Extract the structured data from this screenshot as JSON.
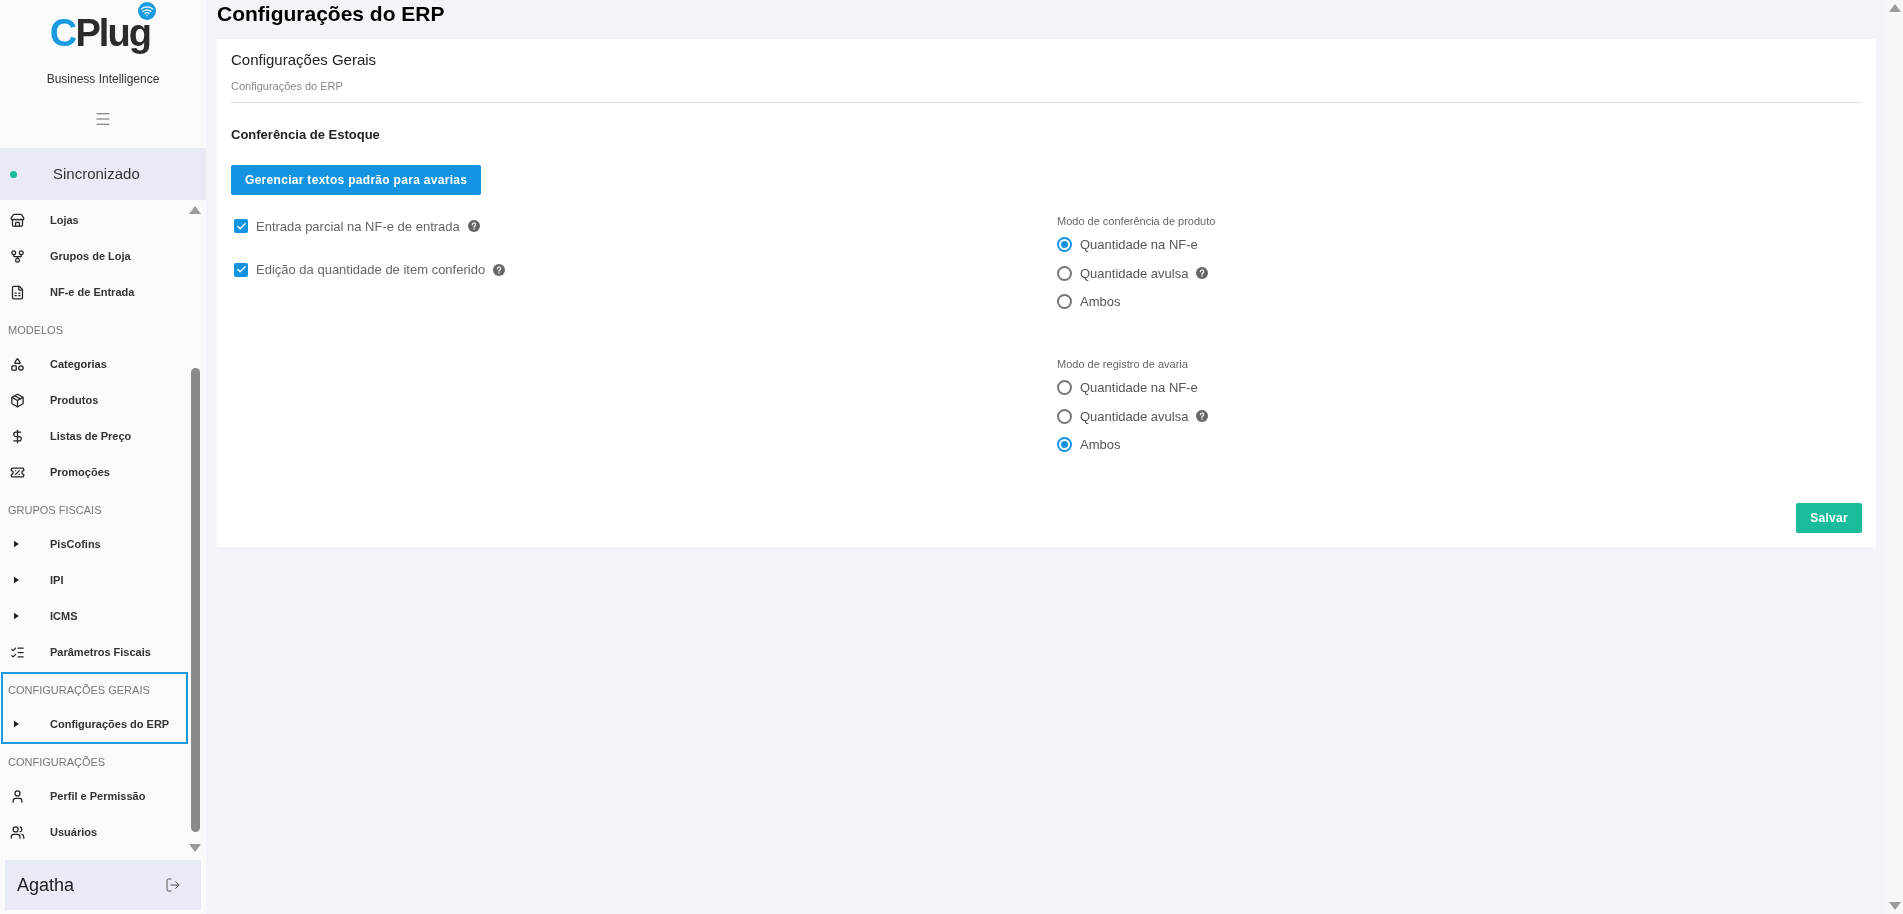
{
  "sidebar": {
    "logo": [
      "C",
      "Plug"
    ],
    "subtitle": "Business Intelligence",
    "status": "Sincronizado",
    "sections": [
      {
        "selected": false,
        "items": [
          {
            "label": "Lojas",
            "kind": "link"
          },
          {
            "label": "Grupos de Loja",
            "kind": "link"
          },
          {
            "label": "NF-e de Entrada",
            "kind": "link"
          }
        ]
      },
      {
        "header": "MODELOS",
        "selected": false,
        "items": [
          {
            "label": "Categorias",
            "kind": "link"
          },
          {
            "label": "Produtos",
            "kind": "link"
          },
          {
            "label": "Listas de Preço",
            "kind": "link"
          },
          {
            "label": "Promoções",
            "kind": "link"
          }
        ]
      },
      {
        "header": "GRUPOS FISCAIS",
        "selected": false,
        "items": [
          {
            "label": "PisCofins",
            "kind": "expandable",
            "expanded": false
          },
          {
            "label": "IPI",
            "kind": "expandable",
            "expanded": false
          },
          {
            "label": "ICMS",
            "kind": "expandable",
            "expanded": false
          },
          {
            "label": "Parâmetros Fiscais",
            "kind": "link"
          }
        ]
      },
      {
        "header": "CONFIGURAÇÕES GERAIS",
        "selected": true,
        "items": [
          {
            "label": "Configurações do ERP",
            "kind": "expandable",
            "expanded": false
          }
        ]
      },
      {
        "header": "CONFIGURAÇÕES",
        "selected": false,
        "items": [
          {
            "label": "Perfil e Permissão",
            "kind": "link"
          },
          {
            "label": "Usuários",
            "kind": "link"
          }
        ]
      }
    ],
    "user": "Agatha"
  },
  "page": {
    "title": "Configurações do ERP",
    "card": {
      "title": "Configurações Gerais",
      "subtitle": "Configurações do ERP",
      "section_title": "Conferência de Estoque",
      "action_button": "Gerenciar textos padrão para avarias",
      "checkboxes": [
        {
          "label": "Entrada parcial na NF-e de entrada",
          "checked": true,
          "help": true
        },
        {
          "label": "Edição da quantidade de item conferido",
          "checked": true,
          "help": true
        }
      ],
      "radio_groups": [
        {
          "label": "Modo de conferência de produto",
          "options": [
            {
              "label": "Quantidade na NF-e",
              "selected": true,
              "help": false
            },
            {
              "label": "Quantidade avulsa",
              "selected": false,
              "help": true
            },
            {
              "label": "Ambos",
              "selected": false,
              "help": false
            }
          ]
        },
        {
          "label": "Modo de registro de avaria",
          "options": [
            {
              "label": "Quantidade na NF-e",
              "selected": false,
              "help": false
            },
            {
              "label": "Quantidade avulsa",
              "selected": false,
              "help": true
            },
            {
              "label": "Ambos",
              "selected": true,
              "help": false
            }
          ]
        }
      ],
      "save_button": "Salvar"
    }
  }
}
